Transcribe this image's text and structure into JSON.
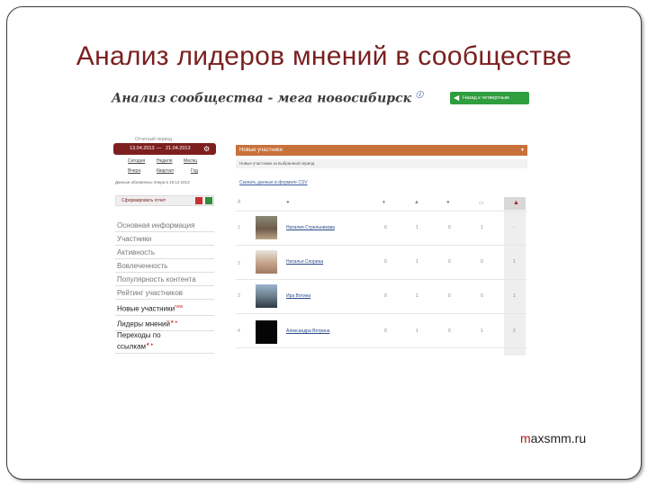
{
  "slide": {
    "title": "Анализ лидеров мнений в сообществе",
    "footer_brand_accent": "m",
    "footer_brand_rest": "axsmm.ru"
  },
  "shot": {
    "title": "Анализ сообщества - мега новосибирск",
    "title_info_icon": "info-icon",
    "back_button_label": "Назад к четвертным",
    "period_label": "Отчетный период",
    "date_from": "13.04.2013",
    "date_sep": "—",
    "date_to": "21.04.2013",
    "period_links": [
      "Сегодня",
      "Неделя",
      "Месяц",
      "Вчера",
      "Квартал",
      "Год"
    ],
    "updated_note": "Данные обновлены: вчера в 10:13 2013",
    "export_label": "Сформировать отчет",
    "side_menu": [
      {
        "label": "Основная информация",
        "star": ""
      },
      {
        "label": "Участники",
        "star": ""
      },
      {
        "label": "Активность",
        "star": ""
      },
      {
        "label": "Вовлеченность",
        "star": ""
      },
      {
        "label": "Популярность контента",
        "star": ""
      },
      {
        "label": "Рейтинг участников",
        "star": ""
      },
      {
        "label": "Новые участники",
        "star": "new"
      },
      {
        "label": "Лидеры мнений",
        "star": "★ ▸"
      },
      {
        "label": "Переходы по",
        "star": ""
      },
      {
        "label": "ссылкам",
        "star": "★ ▸"
      }
    ],
    "section_title": "Новые участники",
    "section_toggle": "▾",
    "filter_note": "Новые участники за выбранный период",
    "download_link": "Скачать данные в формате CSV",
    "column_icons": [
      "#",
      "user-icon",
      "like-icon",
      "repost-icon",
      "comment-icon",
      "post-icon",
      "active-icon"
    ],
    "rows": [
      {
        "num": "1",
        "name": "Наталия Стрельникова",
        "v1": "0",
        "v2": "1",
        "v3": "0",
        "v4": "1",
        "v5": "-"
      },
      {
        "num": "2",
        "name": "Наталья Спорина",
        "v1": "0",
        "v2": "1",
        "v3": "0",
        "v4": "0",
        "v5": "1"
      },
      {
        "num": "3",
        "name": "Ира Вотина",
        "v1": "0",
        "v2": "1",
        "v3": "0",
        "v4": "0",
        "v5": "1"
      },
      {
        "num": "4",
        "name": "Александра Ветрина",
        "v1": "0",
        "v2": "1",
        "v3": "0",
        "v4": "1",
        "v5": "2"
      }
    ]
  }
}
